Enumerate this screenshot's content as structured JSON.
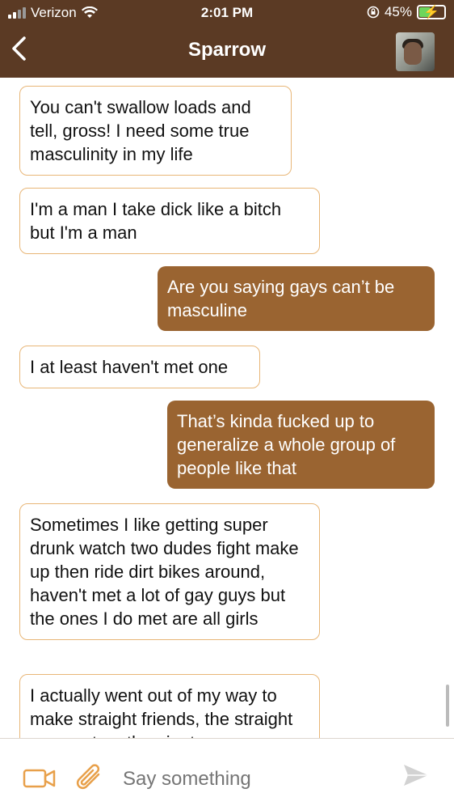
{
  "status": {
    "carrier": "Verizon",
    "time": "2:01 PM",
    "battery": "45%"
  },
  "header": {
    "title": "Sparrow"
  },
  "messages": [
    {
      "side": "in",
      "text": "You can't swallow loads and tell, gross! I need some true masculinity in my life"
    },
    {
      "side": "in",
      "text": "I'm a man I take dick like a bitch but I'm a man"
    },
    {
      "side": "out",
      "text": "Are you saying gays can’t be masculine"
    },
    {
      "side": "in",
      "text": "I at least haven't met one"
    },
    {
      "side": "out",
      "text": "That’s kinda fucked up to generalize a whole group of people like that"
    },
    {
      "side": "in",
      "text": "Sometimes I like getting super drunk watch two dudes fight make up then ride dirt bikes around, haven't met a lot of gay guys but the ones I do met are all girls"
    },
    {
      "side": "in",
      "text": "I actually went out of my way to make straight friends, the straight guys get on the ninet"
    }
  ],
  "composer": {
    "placeholder": "Say something"
  },
  "colors": {
    "header": "#5b3a24",
    "outgoing": "#9a6431",
    "incoming_border": "#e8b677",
    "accent": "#e8a04a"
  },
  "icons": [
    "back-chevron-icon",
    "video-camera-icon",
    "paperclip-icon",
    "send-icon",
    "wifi-icon",
    "battery-icon",
    "signal-icon"
  ]
}
